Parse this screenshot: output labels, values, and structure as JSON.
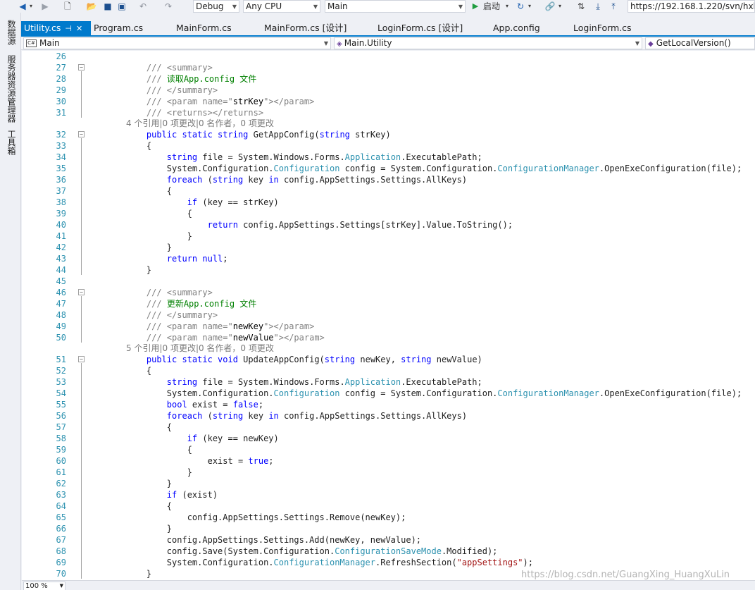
{
  "toolbar": {
    "configuration": "Debug",
    "platform": "Any CPU",
    "startup_project": "Main",
    "start_label": "启动",
    "url": "https://192.168.1.220/svn/hxl"
  },
  "side_tabs": [
    "数据源",
    "服务器资源管理器",
    "工具箱"
  ],
  "tabs": [
    {
      "label": "Utility.cs"
    },
    {
      "label": "Program.cs"
    },
    {
      "label": "MainForm.cs"
    },
    {
      "label": "MainForm.cs [设计]"
    },
    {
      "label": "LoginForm.cs [设计]"
    },
    {
      "label": "App.config"
    },
    {
      "label": "LoginForm.cs"
    }
  ],
  "navbar": {
    "project": "Main",
    "class": "Main.Utility",
    "member": "GetLocalVersion()"
  },
  "editor": {
    "codelens": [
      "4 个引用|0 项更改|0 名作者，0 项更改",
      "5 个引用|0 项更改|0 名作者，0 项更改"
    ],
    "lines": [
      {
        "n": "26",
        "html": ""
      },
      {
        "n": "27",
        "html": "<span class=\"d\">/// &lt;summary&gt;</span>"
      },
      {
        "n": "28",
        "html": "<span class=\"d\">/// </span><span class=\"c\">读取App.config 文件</span>"
      },
      {
        "n": "29",
        "html": "<span class=\"d\">/// &lt;/summary&gt;</span>"
      },
      {
        "n": "30",
        "html": "<span class=\"d\">/// &lt;param name=\"</span><span class=\"p\">strKey</span><span class=\"d\">\"&gt;&lt;/param&gt;</span>"
      },
      {
        "n": "31",
        "html": "<span class=\"d\">/// &lt;returns&gt;&lt;/returns&gt;</span>"
      },
      {
        "n": "32",
        "html": "<span class=\"k\">public static string</span> GetAppConfig(<span class=\"k\">string</span> strKey)"
      },
      {
        "n": "33",
        "html": "{"
      },
      {
        "n": "34",
        "html": "    <span class=\"k\">string</span> file = System.Windows.Forms.<span class=\"t\">Application</span>.ExecutablePath;"
      },
      {
        "n": "35",
        "html": "    System.Configuration.<span class=\"t\">Configuration</span> config = System.Configuration.<span class=\"t\">ConfigurationManager</span>.OpenExeConfiguration(file);"
      },
      {
        "n": "36",
        "html": "    <span class=\"k\">foreach</span> (<span class=\"k\">string</span> key <span class=\"k\">in</span> config.AppSettings.Settings.AllKeys)"
      },
      {
        "n": "37",
        "html": "    {"
      },
      {
        "n": "38",
        "html": "        <span class=\"k\">if</span> (key == strKey)"
      },
      {
        "n": "39",
        "html": "        {"
      },
      {
        "n": "40",
        "html": "            <span class=\"k\">return</span> config.AppSettings.Settings[strKey].Value.ToString();"
      },
      {
        "n": "41",
        "html": "        }"
      },
      {
        "n": "42",
        "html": "    }"
      },
      {
        "n": "43",
        "html": "    <span class=\"k\">return null</span>;"
      },
      {
        "n": "44",
        "html": "}"
      },
      {
        "n": "45",
        "html": ""
      },
      {
        "n": "46",
        "html": "<span class=\"d\">/// &lt;summary&gt;</span>"
      },
      {
        "n": "47",
        "html": "<span class=\"d\">/// </span><span class=\"c\">更新App.config 文件</span>"
      },
      {
        "n": "48",
        "html": "<span class=\"d\">/// &lt;/summary&gt;</span>"
      },
      {
        "n": "49",
        "html": "<span class=\"d\">/// &lt;param name=\"</span><span class=\"p\">newKey</span><span class=\"d\">\"&gt;&lt;/param&gt;</span>"
      },
      {
        "n": "50",
        "html": "<span class=\"d\">/// &lt;param name=\"</span><span class=\"p\">newValue</span><span class=\"d\">\"&gt;&lt;/param&gt;</span>"
      },
      {
        "n": "51",
        "html": "<span class=\"k\">public static void</span> UpdateAppConfig(<span class=\"k\">string</span> newKey, <span class=\"k\">string</span> newValue)"
      },
      {
        "n": "52",
        "html": "{"
      },
      {
        "n": "53",
        "html": "    <span class=\"k\">string</span> file = System.Windows.Forms.<span class=\"t\">Application</span>.ExecutablePath;"
      },
      {
        "n": "54",
        "html": "    System.Configuration.<span class=\"t\">Configuration</span> config = System.Configuration.<span class=\"t\">ConfigurationManager</span>.OpenExeConfiguration(file);"
      },
      {
        "n": "55",
        "html": "    <span class=\"k\">bool</span> exist = <span class=\"k\">false</span>;"
      },
      {
        "n": "56",
        "html": "    <span class=\"k\">foreach</span> (<span class=\"k\">string</span> key <span class=\"k\">in</span> config.AppSettings.Settings.AllKeys)"
      },
      {
        "n": "57",
        "html": "    {"
      },
      {
        "n": "58",
        "html": "        <span class=\"k\">if</span> (key == newKey)"
      },
      {
        "n": "59",
        "html": "        {"
      },
      {
        "n": "60",
        "html": "            exist = <span class=\"k\">true</span>;"
      },
      {
        "n": "61",
        "html": "        }"
      },
      {
        "n": "62",
        "html": "    }"
      },
      {
        "n": "63",
        "html": "    <span class=\"k\">if</span> (exist)"
      },
      {
        "n": "64",
        "html": "    {"
      },
      {
        "n": "65",
        "html": "        config.AppSettings.Settings.Remove(newKey);"
      },
      {
        "n": "66",
        "html": "    }"
      },
      {
        "n": "67",
        "html": "    config.AppSettings.Settings.Add(newKey, newValue);"
      },
      {
        "n": "68",
        "html": "    config.Save(System.Configuration.<span class=\"t\">ConfigurationSaveMode</span>.Modified);"
      },
      {
        "n": "69",
        "html": "    System.Configuration.<span class=\"t\">ConfigurationManager</span>.RefreshSection(<span class=\"s\">\"appSettings\"</span>);"
      },
      {
        "n": "70",
        "html": "}"
      }
    ]
  },
  "status": {
    "zoom": "100 %"
  },
  "watermark": "https://blog.csdn.net/GuangXing_HuangXuLin",
  "colors": {
    "accent": "#007acc",
    "keyword": "#0000ff",
    "type": "#2b91af",
    "comment": "#008000",
    "string": "#a31515"
  }
}
